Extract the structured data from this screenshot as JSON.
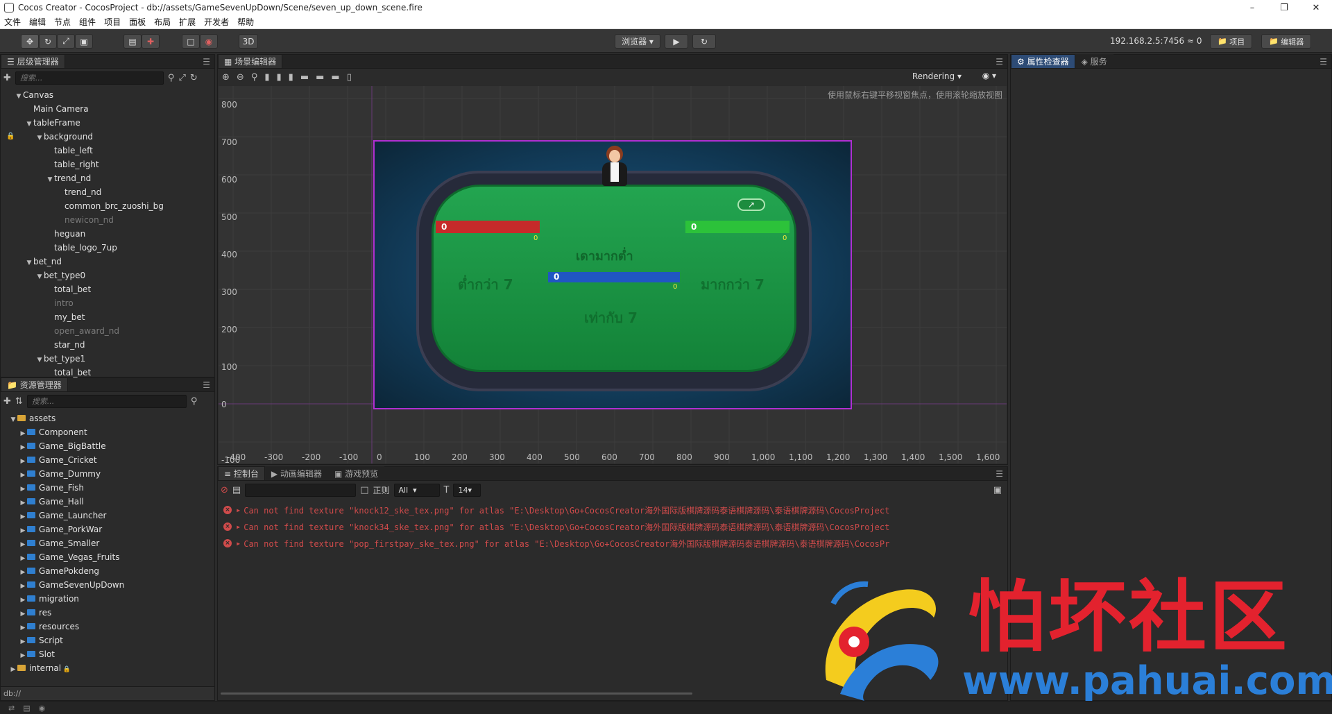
{
  "window": {
    "title": "Cocos Creator - CocosProject - db://assets/GameSevenUpDown/Scene/seven_up_down_scene.fire"
  },
  "menu": [
    "文件",
    "编辑",
    "节点",
    "组件",
    "项目",
    "面板",
    "布局",
    "扩展",
    "开发者",
    "帮助"
  ],
  "toolbar": {
    "browser_label": "浏览器 ▾",
    "mode_3d": "3D",
    "ip": "192.168.2.5:7456",
    "connections": "0",
    "project_btn": "项目",
    "editor_btn": "编辑器"
  },
  "hierarchy": {
    "tab": "层级管理器",
    "search_placeholder": "搜索...",
    "nodes": [
      {
        "label": "Canvas",
        "depth": 0,
        "expand": "▼"
      },
      {
        "label": "Main Camera",
        "depth": 1,
        "expand": ""
      },
      {
        "label": "tableFrame",
        "depth": 1,
        "expand": "▼"
      },
      {
        "label": "background",
        "depth": 2,
        "expand": "▼",
        "locked": true
      },
      {
        "label": "table_left",
        "depth": 3,
        "expand": ""
      },
      {
        "label": "table_right",
        "depth": 3,
        "expand": ""
      },
      {
        "label": "trend_nd",
        "depth": 3,
        "expand": "▼"
      },
      {
        "label": "trend_nd",
        "depth": 4,
        "expand": ""
      },
      {
        "label": "common_brc_zuoshi_bg",
        "depth": 4,
        "expand": ""
      },
      {
        "label": "newicon_nd",
        "depth": 4,
        "expand": "",
        "dim": true
      },
      {
        "label": "heguan",
        "depth": 3,
        "expand": ""
      },
      {
        "label": "table_logo_7up",
        "depth": 3,
        "expand": ""
      },
      {
        "label": "bet_nd",
        "depth": 1,
        "expand": "▼"
      },
      {
        "label": "bet_type0",
        "depth": 2,
        "expand": "▼"
      },
      {
        "label": "total_bet",
        "depth": 3,
        "expand": ""
      },
      {
        "label": "intro",
        "depth": 3,
        "expand": "",
        "dim": true
      },
      {
        "label": "my_bet",
        "depth": 3,
        "expand": ""
      },
      {
        "label": "open_award_nd",
        "depth": 3,
        "expand": "",
        "dim": true
      },
      {
        "label": "star_nd",
        "depth": 3,
        "expand": ""
      },
      {
        "label": "bet_type1",
        "depth": 2,
        "expand": "▼"
      },
      {
        "label": "total_bet",
        "depth": 3,
        "expand": ""
      }
    ]
  },
  "assets": {
    "tab": "资源管理器",
    "search_placeholder": "搜索...",
    "root": "assets",
    "folders": [
      "Component",
      "Game_BigBattle",
      "Game_Cricket",
      "Game_Dummy",
      "Game_Fish",
      "Game_Hall",
      "Game_Launcher",
      "Game_PorkWar",
      "Game_Smaller",
      "Game_Vegas_Fruits",
      "GamePokdeng",
      "GameSevenUpDown",
      "migration",
      "res",
      "resources",
      "Script",
      "Slot"
    ],
    "internal": "internal",
    "footer": "db://"
  },
  "scene": {
    "tab": "场景编辑器",
    "rendering": "Rendering",
    "hint": "使用鼠标右键平移视窗焦点，使用滚轮缩放视图",
    "y_ticks": [
      "800",
      "700",
      "600",
      "500",
      "400",
      "300",
      "200",
      "100",
      "0",
      "-100"
    ],
    "x_ticks": [
      "-400",
      "-300",
      "-200",
      "-100",
      "0",
      "100",
      "200",
      "300",
      "400",
      "500",
      "600",
      "700",
      "800",
      "900",
      "1,000",
      "1,100",
      "1,200",
      "1,300",
      "1,400",
      "1,500",
      "1,600"
    ],
    "game": {
      "left_total": "0",
      "left_small": "0",
      "right_total": "0",
      "right_small": "0",
      "center_total": "0",
      "center_small": "0",
      "logo_text": "เดามากต่ำ",
      "left_label": "ต่ำกว่า 7",
      "right_label": "มากกว่า 7",
      "center_label": "เท่ากับ 7"
    }
  },
  "console": {
    "tabs": [
      "控制台",
      "动画编辑器",
      "游戏预览"
    ],
    "regex_label": "正则",
    "filter": "All",
    "font_size": "14",
    "errors": [
      "Can not find texture \"knock12_ske_tex.png\" for atlas \"E:\\Desktop\\Go+CocosCreator海外国际版棋牌源码泰语棋牌源码\\泰语棋牌源码\\CocosProject",
      "Can not find texture \"knock34_ske_tex.png\" for atlas \"E:\\Desktop\\Go+CocosCreator海外国际版棋牌源码泰语棋牌源码\\泰语棋牌源码\\CocosProject",
      "Can not find texture \"pop_firstpay_ske_tex.png\" for atlas \"E:\\Desktop\\Go+CocosCreator海外国际版棋牌源码泰语棋牌源码\\泰语棋牌源码\\CocosPr"
    ]
  },
  "inspector": {
    "tab": "属性检查器",
    "service_tab": "服务"
  },
  "watermark": {
    "text_cn": "怕坏社区",
    "url": "www.pahuai.com"
  }
}
